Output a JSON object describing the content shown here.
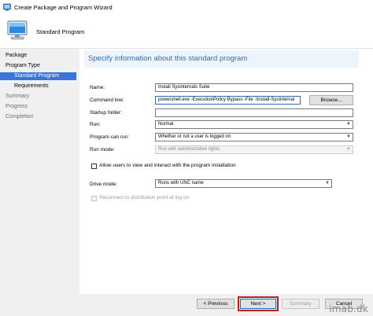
{
  "window": {
    "title": "Create Package and Program Wizard"
  },
  "header": {
    "title": "Standard Program"
  },
  "nav": {
    "items": [
      {
        "label": "Package",
        "state": "done"
      },
      {
        "label": "Program Type",
        "state": "done"
      },
      {
        "label": "Standard Program",
        "state": "selected"
      },
      {
        "label": "Requirements",
        "state": "pending"
      },
      {
        "label": "Summary",
        "state": "pending"
      },
      {
        "label": "Progress",
        "state": "pending"
      },
      {
        "label": "Completion",
        "state": "pending"
      }
    ]
  },
  "main": {
    "heading": "Specify information about this standard program",
    "name_label": "Name:",
    "name_value": "Install Sysinternals Suite",
    "command_label": "Command line:",
    "command_value": "powershell.exe -ExecutionPolicy Bypass -File .\\Install-SysInternal",
    "browse_label": "Browse...",
    "startup_label": "Startup folder:",
    "startup_value": "",
    "run_label": "Run:",
    "run_value": "Normal",
    "program_can_run_label": "Program can run:",
    "program_can_run_value": "Whether or not a user is logged on",
    "run_mode_label": "Run mode:",
    "run_mode_value": "Run with administrative rights",
    "allow_interact_label": "Allow users to view and interact with the program installation",
    "drive_mode_label": "Drive mode:",
    "drive_mode_value": "Runs with UNC name",
    "reconnect_label": "Reconnect to distribution point at log on"
  },
  "footer": {
    "previous_label": "< Previous",
    "next_label": "Next >",
    "summary_label": "Summary",
    "cancel_label": "Cancel"
  },
  "watermark": "imab.dk",
  "colors": {
    "accent": "#2e6db5",
    "nav_selected": "#3875d7",
    "highlight": "#c8191b"
  },
  "icons": [
    "app-icon",
    "computer-icon",
    "chevron-down-icon"
  ]
}
